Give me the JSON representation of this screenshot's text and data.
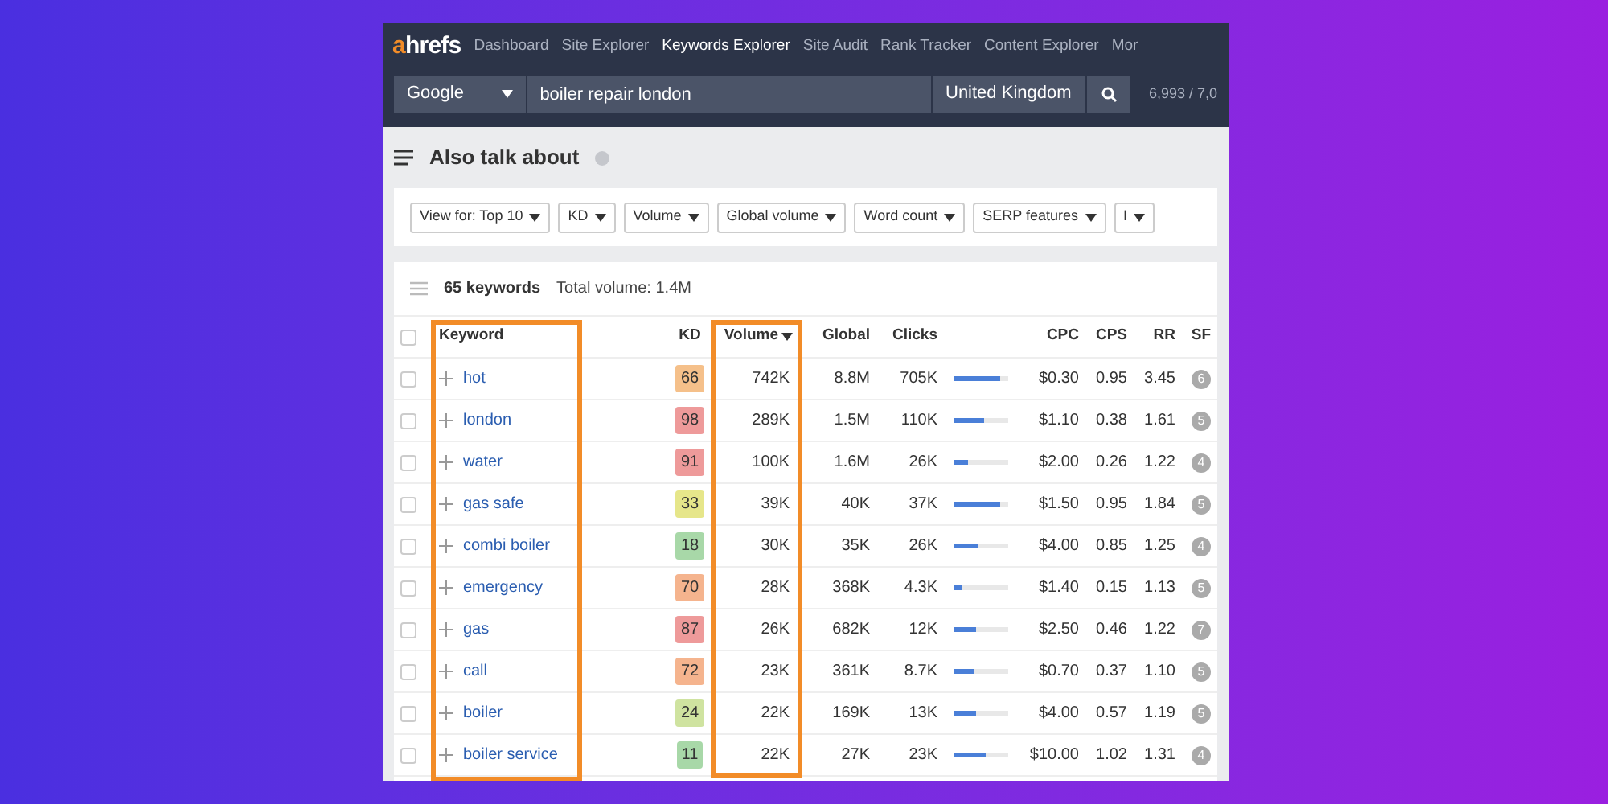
{
  "nav": {
    "logo_accent": "a",
    "logo_rest": "hrefs",
    "items": [
      {
        "label": "Dashboard",
        "selected": false
      },
      {
        "label": "Site Explorer",
        "selected": false
      },
      {
        "label": "Keywords Explorer",
        "selected": true
      },
      {
        "label": "Site Audit",
        "selected": false
      },
      {
        "label": "Rank Tracker",
        "selected": false
      },
      {
        "label": "Content Explorer",
        "selected": false
      },
      {
        "label": "Mor",
        "selected": false
      }
    ]
  },
  "search": {
    "engine": "Google",
    "query": "boiler repair london",
    "country": "United Kingdom",
    "credits": "6,993 / 7,0"
  },
  "page_title": "Also talk about",
  "filters": [
    "View for: Top 10",
    "KD",
    "Volume",
    "Global volume",
    "Word count",
    "SERP features",
    "I"
  ],
  "summary": {
    "count": "65 keywords",
    "total": "Total volume: 1.4M"
  },
  "select_all_checked": false,
  "columns": [
    "Keyword",
    "KD",
    "Volume",
    "Global",
    "Clicks",
    "CPC",
    "CPS",
    "RR",
    "SF"
  ],
  "rows": [
    {
      "checked": false,
      "keyword": "hot",
      "kd": "66",
      "color": "#f5c08a",
      "volume": "742K",
      "global": "8.8M",
      "clicks": "705K",
      "level": 0.85,
      "cpc": "$0.30",
      "cps": "0.95",
      "rr": "3.45",
      "sf": "6"
    },
    {
      "checked": false,
      "keyword": "london",
      "kd": "98",
      "color": "#ee9a9a",
      "volume": "289K",
      "global": "1.5M",
      "clicks": "110K",
      "level": 0.55,
      "cpc": "$1.10",
      "cps": "0.38",
      "rr": "1.61",
      "sf": "5"
    },
    {
      "checked": false,
      "keyword": "water",
      "kd": "91",
      "color": "#ee9a9a",
      "volume": "100K",
      "global": "1.6M",
      "clicks": "26K",
      "level": 0.25,
      "cpc": "$2.00",
      "cps": "0.26",
      "rr": "1.22",
      "sf": "4"
    },
    {
      "checked": false,
      "keyword": "gas safe",
      "kd": "33",
      "color": "#e6e68a",
      "volume": "39K",
      "global": "40K",
      "clicks": "37K",
      "level": 0.85,
      "cpc": "$1.50",
      "cps": "0.95",
      "rr": "1.84",
      "sf": "5"
    },
    {
      "checked": false,
      "keyword": "combi boiler",
      "kd": "18",
      "color": "#a8d8a8",
      "volume": "30K",
      "global": "35K",
      "clicks": "26K",
      "level": 0.45,
      "cpc": "$4.00",
      "cps": "0.85",
      "rr": "1.25",
      "sf": "4"
    },
    {
      "checked": false,
      "keyword": "emergency",
      "kd": "70",
      "color": "#f5b48e",
      "volume": "28K",
      "global": "368K",
      "clicks": "4.3K",
      "level": 0.15,
      "cpc": "$1.40",
      "cps": "0.15",
      "rr": "1.13",
      "sf": "5"
    },
    {
      "checked": false,
      "keyword": "gas",
      "kd": "87",
      "color": "#ee9a9a",
      "volume": "26K",
      "global": "682K",
      "clicks": "12K",
      "level": 0.42,
      "cpc": "$2.50",
      "cps": "0.46",
      "rr": "1.22",
      "sf": "7"
    },
    {
      "checked": false,
      "keyword": "call",
      "kd": "72",
      "color": "#f5b48e",
      "volume": "23K",
      "global": "361K",
      "clicks": "8.7K",
      "level": 0.38,
      "cpc": "$0.70",
      "cps": "0.37",
      "rr": "1.10",
      "sf": "5"
    },
    {
      "checked": false,
      "keyword": "boiler",
      "kd": "24",
      "color": "#cfe3a0",
      "volume": "22K",
      "global": "169K",
      "clicks": "13K",
      "level": 0.4,
      "cpc": "$4.00",
      "cps": "0.57",
      "rr": "1.19",
      "sf": "5"
    },
    {
      "checked": false,
      "keyword": "boiler service",
      "kd": "11",
      "color": "#a8d8a8",
      "volume": "22K",
      "global": "27K",
      "clicks": "23K",
      "level": 0.6,
      "cpc": "$10.00",
      "cps": "1.02",
      "rr": "1.31",
      "sf": "4"
    }
  ]
}
